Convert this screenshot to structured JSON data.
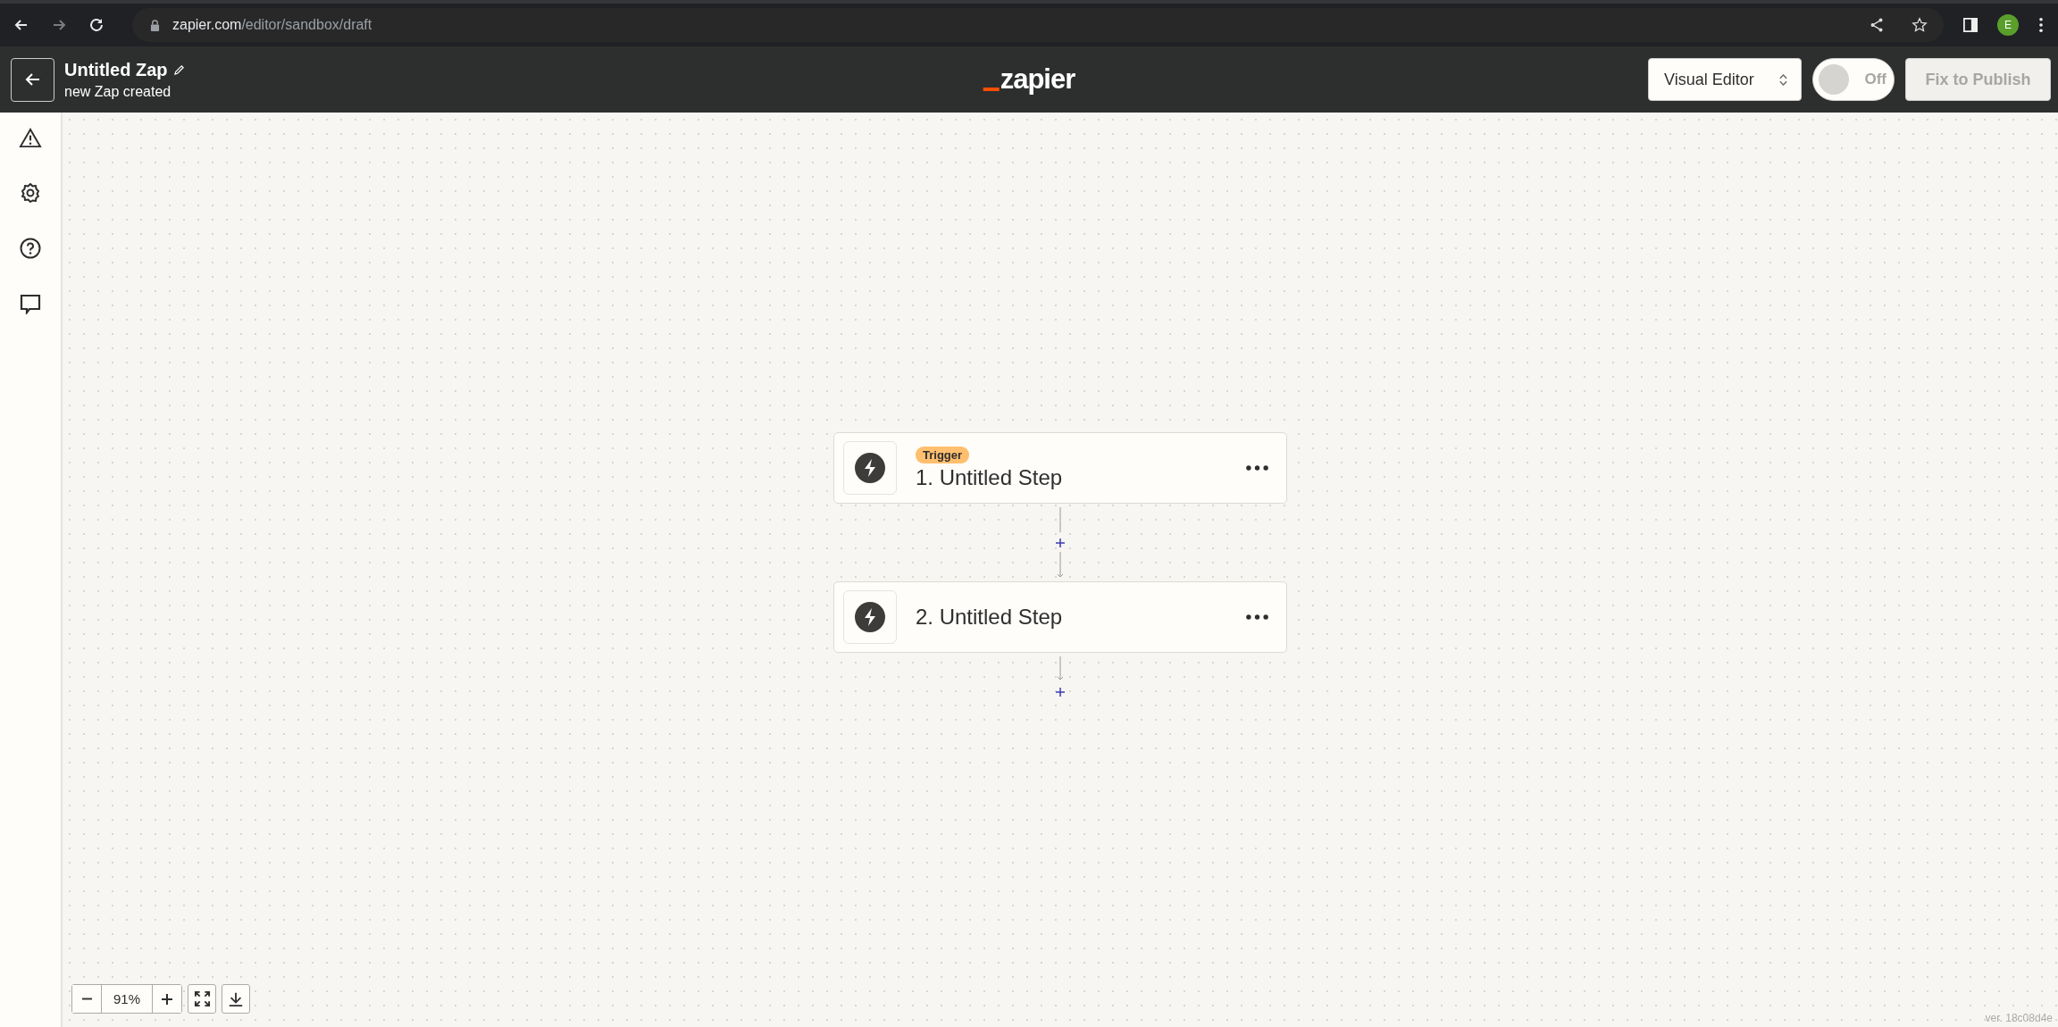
{
  "browser": {
    "back_disabled": false,
    "forward_disabled": true,
    "url_host": "zapier.com",
    "url_path": "/editor/sandbox/draft",
    "profile_initial": "E"
  },
  "header": {
    "title": "Untitled Zap",
    "subtitle": "new Zap created",
    "logo": "zapier",
    "editor_select": "Visual Editor",
    "toggle": {
      "label": "Off",
      "on": false
    },
    "publish_button": {
      "label": "Fix to Publish",
      "disabled": true
    }
  },
  "steps": [
    {
      "badge": "Trigger",
      "title": "1. Untitled Step"
    },
    {
      "title": "2. Untitled Step"
    }
  ],
  "zoom": {
    "value": "91%"
  },
  "version": "ver. 18c08d4e"
}
